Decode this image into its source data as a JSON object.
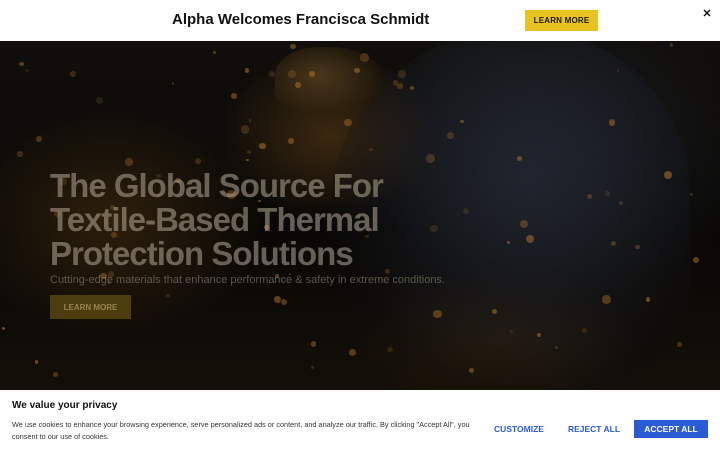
{
  "announcement": {
    "title": "Alpha Welcomes Francisca Schmidt",
    "button_label": "LEARN MORE",
    "close_symbol": "✕",
    "button_color": "#e8c21f"
  },
  "hero": {
    "heading": "The Global Source For Textile-Based Thermal Protection Solutions",
    "subheading": "Cutting-edge materials that enhance performance & safety in extreme conditions.",
    "button_label": "LEARN MORE"
  },
  "cookie": {
    "title": "We value your privacy",
    "text": "We use cookies to enhance your browsing experience, serve personalized ads or content, and analyze our traffic. By clicking \"Accept All\", you consent to our use of cookies.",
    "customize_label": "CUSTOMIZE",
    "reject_label": "REJECT ALL",
    "accept_label": "ACCEPT ALL",
    "accent_color": "#2a5bd7"
  }
}
